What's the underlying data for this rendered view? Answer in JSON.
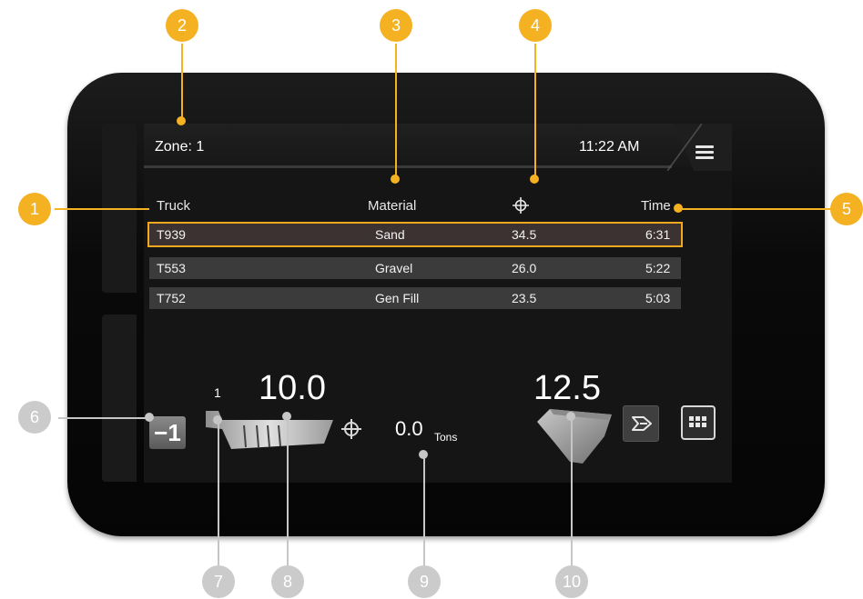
{
  "screen": {
    "zone": "Zone: 1",
    "time": "11:22 AM",
    "columns": {
      "truck": "Truck",
      "material": "Material",
      "time": "Time"
    },
    "rows": [
      {
        "truck": "T939",
        "material": "Sand",
        "weight": "34.5",
        "time": "6:31",
        "selected": true
      },
      {
        "truck": "T553",
        "material": "Gravel",
        "weight": "26.0",
        "time": "5:22",
        "selected": false
      },
      {
        "truck": "T752",
        "material": "Gen Fill",
        "weight": "23.5",
        "time": "5:03",
        "selected": false
      }
    ],
    "pass_button": "−1",
    "pass_count": "1",
    "truck_payload": "10.0",
    "target_value": "0.0",
    "target_unit": "Tons",
    "bucket_payload": "12.5"
  },
  "callouts": [
    "1",
    "2",
    "3",
    "4",
    "5",
    "6",
    "7",
    "8",
    "9",
    "10"
  ],
  "colors": {
    "highlight": "#f4a81d",
    "callout_orange": "#f4b223",
    "callout_grey": "#cbcbcb",
    "screen_bg": "#151515"
  },
  "icons": [
    "menu-icon",
    "crosshair-icon",
    "truck-bed-icon",
    "bucket-icon",
    "dump-icon",
    "keypad-icon"
  ]
}
